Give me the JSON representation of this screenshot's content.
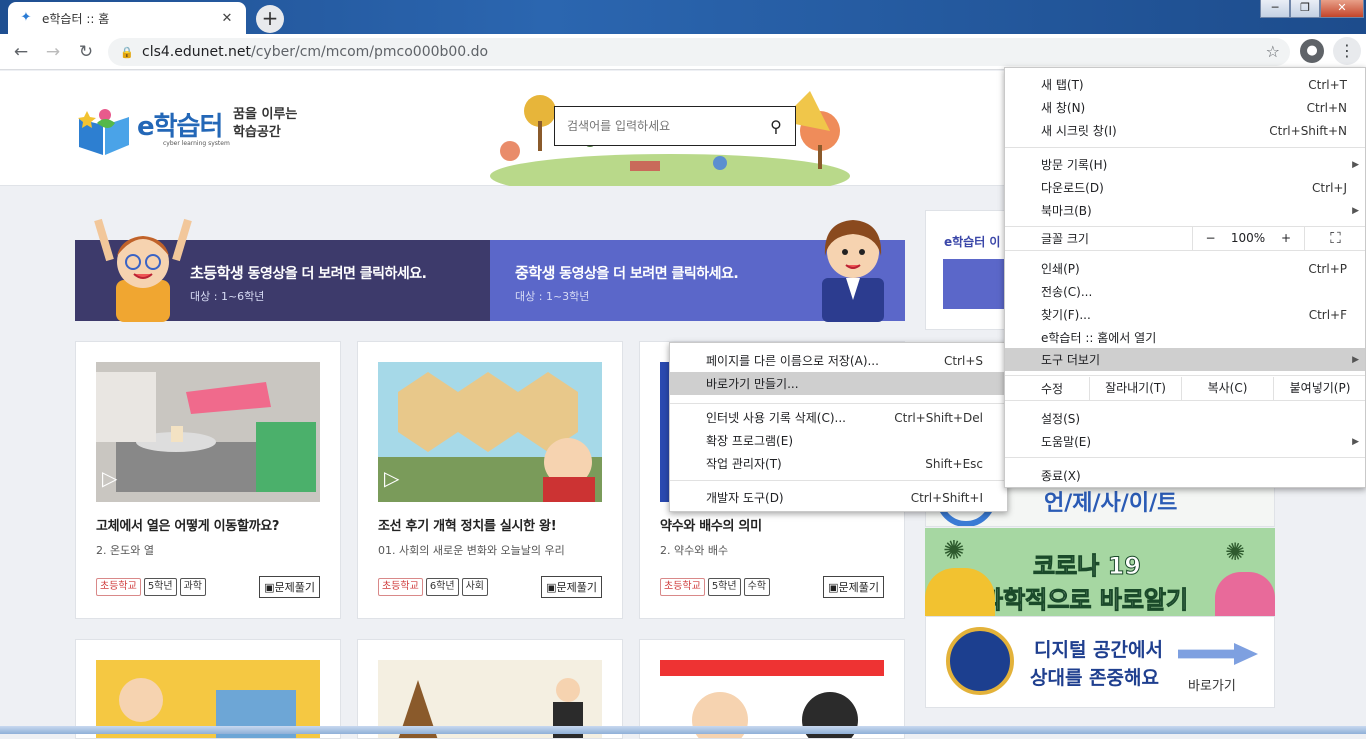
{
  "browser": {
    "tab_title": "e학습터 :: 홈",
    "url_host": "cls4.edunet.net",
    "url_path": "/cyber/cm/mcom/pmco000b00.do",
    "window_buttons": [
      "─",
      "❐",
      "✕"
    ]
  },
  "site": {
    "logo_brand": "e학습터",
    "logo_sub": "cyber learning system",
    "slogan_line1": "꿈을 이루는",
    "slogan_line2": "학습공간",
    "search_placeholder": "검색어를 입력하세요"
  },
  "banners": [
    {
      "title_em": "초등학생",
      "title_rest": " 동영상을 더 보려면 클릭하세요.",
      "subtitle": "대상 : 1~6학년"
    },
    {
      "title_em": "중학생",
      "title_rest": " 동영상을 더 보려면 클릭하세요.",
      "subtitle": "대상 : 1~3학년"
    }
  ],
  "cards": [
    {
      "title": "고체에서 열은 어떻게 이동할까요?",
      "subtitle": "2. 온도와 열",
      "tags": [
        "초등학교",
        "5학년",
        "과학"
      ],
      "button": "문제풀기"
    },
    {
      "title": "조선 후기 개혁 정치를 실시한 왕!",
      "subtitle": "01. 사회의 새로운 변화와 오늘날의 우리",
      "tags": [
        "초등학교",
        "6학년",
        "사회"
      ],
      "button": "문제풀기"
    },
    {
      "title": "약수와 배수의 의미",
      "subtitle": "2. 약수와 배수",
      "tags": [
        "초등학교",
        "5학년",
        "수학"
      ],
      "button": "문제풀기"
    }
  ],
  "side": {
    "panel_title": "e학습터 이",
    "ad1_text": "언/제/사/이/트",
    "ad2_line1": "코로나 19",
    "ad2_line2": "과학적으로 바로알기",
    "ad3_line1": "디지털 공간에서",
    "ad3_line2": "상대를 존중해요",
    "ad3_link": "바로가기"
  },
  "chrome_menu": {
    "new_tab": {
      "label": "새 탭(T)",
      "accel": "Ctrl+T"
    },
    "new_window": {
      "label": "새 창(N)",
      "accel": "Ctrl+N"
    },
    "incognito": {
      "label": "새 시크릿 창(I)",
      "accel": "Ctrl+Shift+N"
    },
    "history": {
      "label": "방문 기록(H)"
    },
    "downloads": {
      "label": "다운로드(D)",
      "accel": "Ctrl+J"
    },
    "bookmarks": {
      "label": "북마크(B)"
    },
    "zoom": {
      "label": "글꼴 크기",
      "minus": "−",
      "value": "100%",
      "plus": "+",
      "fullscreen": "⛶"
    },
    "print": {
      "label": "인쇄(P)",
      "accel": "Ctrl+P"
    },
    "cast": {
      "label": "전송(C)..."
    },
    "find": {
      "label": "찾기(F)...",
      "accel": "Ctrl+F"
    },
    "open_in": {
      "label": "e학습터 :: 홈에서 열기"
    },
    "more_tools": {
      "label": "도구 더보기"
    },
    "edit": {
      "label": "수정",
      "cut": "잘라내기(T)",
      "copy": "복사(C)",
      "paste": "붙여넣기(P)"
    },
    "settings": {
      "label": "설정(S)"
    },
    "help": {
      "label": "도움말(E)"
    },
    "exit": {
      "label": "종료(X)"
    }
  },
  "more_tools_menu": {
    "save_as": {
      "label": "페이지를 다른 이름으로 저장(A)...",
      "accel": "Ctrl+S"
    },
    "shortcut": {
      "label": "바로가기 만들기..."
    },
    "clear_data": {
      "label": "인터넷 사용 기록 삭제(C)...",
      "accel": "Ctrl+Shift+Del"
    },
    "extensions": {
      "label": "확장 프로그램(E)"
    },
    "task_manager": {
      "label": "작업 관리자(T)",
      "accel": "Shift+Esc"
    },
    "devtools": {
      "label": "개발자 도구(D)",
      "accel": "Ctrl+Shift+I"
    }
  },
  "colors": {
    "elem_banner": "#3d3a6b",
    "mid_banner": "#5b67c9",
    "menu_highlight": "#cfcfcf"
  }
}
